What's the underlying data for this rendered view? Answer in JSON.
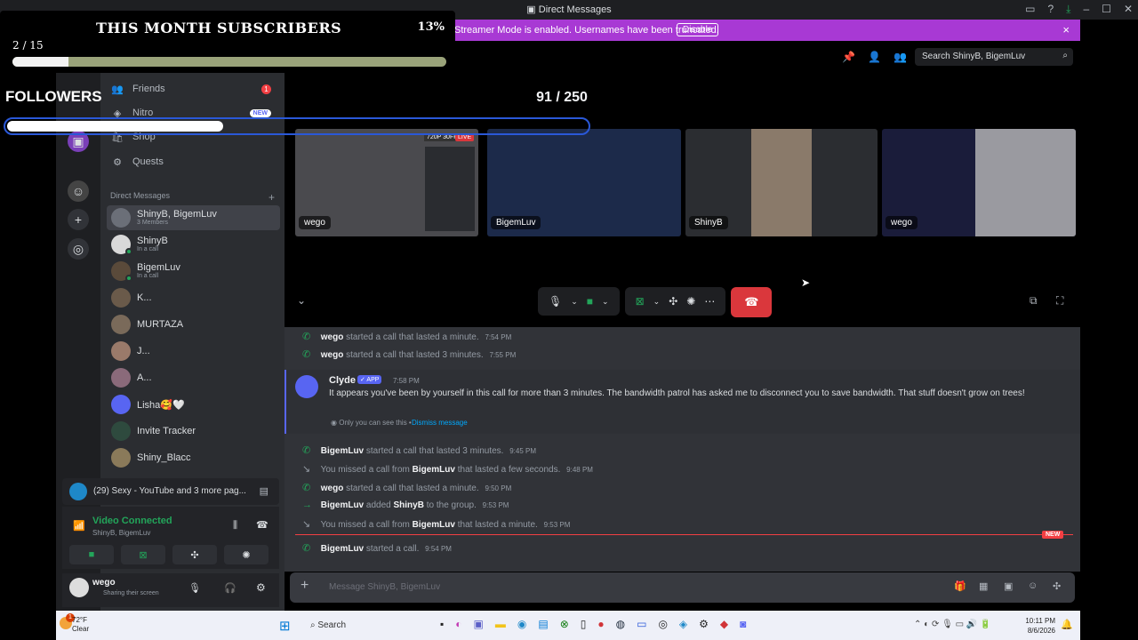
{
  "window": {
    "title": "Direct Messages"
  },
  "banner": {
    "text": "Streamer Mode is enabled. Usernames have been truncated.",
    "button": "Disable",
    "close": "×"
  },
  "overlay": {
    "title": "THIS MONTH SUBSCRIBERS",
    "percent": "13%",
    "count": "2 / 15",
    "progress": 0.13,
    "followers_label": "FOLLOWERS",
    "followers_progress": 0.37
  },
  "nav": {
    "friends": "Friends",
    "friends_badge": "1",
    "nitro": "Nitro",
    "nitro_badge": "NEW",
    "shop": "Shop",
    "quests": "Quests"
  },
  "dm_header": {
    "label": "Direct Messages",
    "add": "+"
  },
  "dms": [
    {
      "name": "ShinyB, BigemLuv",
      "sub": "3 Members"
    },
    {
      "name": "ShinyB",
      "sub": "In a call"
    },
    {
      "name": "BigemLuv",
      "sub": "In a call"
    },
    {
      "name": "K..."
    },
    {
      "name": "MURTAZA"
    },
    {
      "name": "J..."
    },
    {
      "name": "A..."
    },
    {
      "name": "Lisha🥰🤍"
    },
    {
      "name": "Invite Tracker"
    },
    {
      "name": "Shiny_Blacc"
    }
  ],
  "activity": {
    "text": "(29) Sexy - YouTube and 3 more pag..."
  },
  "voice": {
    "status": "Video Connected",
    "channel": "ShinyB, BigemLuv"
  },
  "user": {
    "name": "wego",
    "status": "Sharing their screen"
  },
  "search": {
    "placeholder": "Search ShinyB, BigemLuv"
  },
  "call": {
    "count": "91 / 250",
    "tiles": [
      {
        "label": "wego",
        "live": "LIVE",
        "quality": "720P 30FPS"
      },
      {
        "label": "BigemLuv"
      },
      {
        "label": "ShinyB"
      },
      {
        "label": "wego"
      }
    ]
  },
  "messages": [
    {
      "user": "wego",
      "text": "started a call that lasted a minute.",
      "time": "7:54 PM",
      "kind": "call"
    },
    {
      "user": "wego",
      "text": "started a call that lasted 3 minutes.",
      "time": "7:55 PM",
      "kind": "call"
    },
    {
      "user": "BigemLuv",
      "text": "started a call that lasted 3 minutes.",
      "time": "9:45 PM",
      "kind": "call"
    },
    {
      "pre": "You missed a call from",
      "user": "BigemLuv",
      "text": "that lasted a few seconds.",
      "time": "9:48 PM",
      "kind": "missed"
    },
    {
      "user": "wego",
      "text": "started a call that lasted a minute.",
      "time": "9:50 PM",
      "kind": "call"
    },
    {
      "user": "BigemLuv",
      "text": "added",
      "target": "ShinyB",
      "text2": "to the group.",
      "time": "9:53 PM",
      "kind": "add"
    },
    {
      "pre": "You missed a call from",
      "user": "BigemLuv",
      "text": "that lasted a minute.",
      "time": "9:53 PM",
      "kind": "missed"
    },
    {
      "user": "BigemLuv",
      "text": "started a call.",
      "time": "9:54 PM",
      "kind": "call"
    }
  ],
  "clyde": {
    "name": "Clyde",
    "tag": "✓ APP",
    "time": "7:58 PM",
    "text": "It appears you've been by yourself in this call for more than 3 minutes. The bandwidth patrol has asked me to disconnect you to save bandwidth. That stuff doesn't grow on trees!",
    "note": "Only you can see this •",
    "dismiss": "Dismiss message"
  },
  "new_label": "NEW",
  "composer": {
    "placeholder": "Message ShinyB, BigemLuv",
    "plus": "+"
  },
  "taskbar": {
    "temp": "72°F",
    "cond": "Clear",
    "search": "Search",
    "time": "10:11 PM",
    "date": "8/6/2026",
    "weather_badge": "1"
  },
  "colors": {
    "accent": "#5865f2",
    "green": "#23a55a",
    "red": "#da373c",
    "banner": "#a839d4"
  }
}
